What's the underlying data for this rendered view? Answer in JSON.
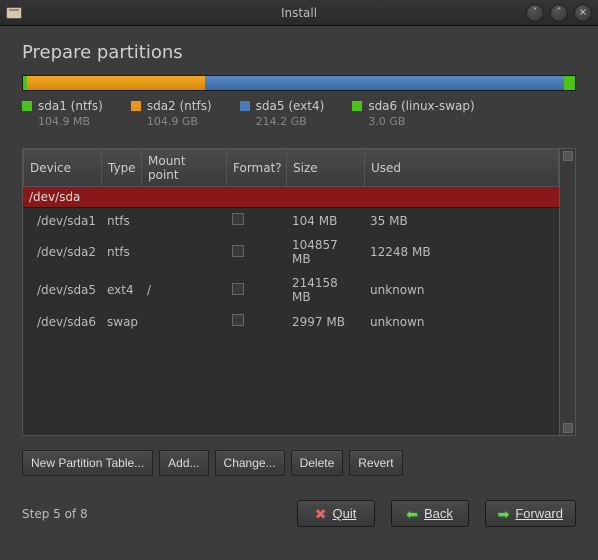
{
  "window": {
    "title": "Install"
  },
  "heading": "Prepare partitions",
  "legend": [
    {
      "swatch": "sw-green",
      "label": "sda1 (ntfs)",
      "size": "104.9 MB"
    },
    {
      "swatch": "sw-orange",
      "label": "sda2 (ntfs)",
      "size": "104.9 GB"
    },
    {
      "swatch": "sw-blue",
      "label": "sda5 (ext4)",
      "size": "214.2 GB"
    },
    {
      "swatch": "sw-green",
      "label": "sda6 (linux-swap)",
      "size": "3.0 GB"
    }
  ],
  "columns": {
    "device": "Device",
    "type": "Type",
    "mount": "Mount point",
    "format": "Format?",
    "size": "Size",
    "used": "Used"
  },
  "disk_row": "/dev/sda",
  "rows": [
    {
      "device": "/dev/sda1",
      "type": "ntfs",
      "mount": "",
      "size": "104 MB",
      "used": "35 MB"
    },
    {
      "device": "/dev/sda2",
      "type": "ntfs",
      "mount": "",
      "size": "104857 MB",
      "used": "12248 MB"
    },
    {
      "device": "/dev/sda5",
      "type": "ext4",
      "mount": "/",
      "size": "214158 MB",
      "used": "unknown"
    },
    {
      "device": "/dev/sda6",
      "type": "swap",
      "mount": "",
      "size": "2997 MB",
      "used": "unknown"
    }
  ],
  "buttons": {
    "new_table": "New Partition Table...",
    "add": "Add...",
    "change": "Change...",
    "delete": "Delete",
    "revert": "Revert"
  },
  "footer": {
    "step": "Step 5 of 8",
    "quit": "Quit",
    "back": "Back",
    "forward": "Forward"
  },
  "chart_data": {
    "type": "bar",
    "title": "Disk partition layout",
    "unit": "GB",
    "series": [
      {
        "name": "sda1 (ntfs)",
        "value": 0.1049,
        "color": "#4cc417"
      },
      {
        "name": "sda2 (ntfs)",
        "value": 104.9,
        "color": "#e69516"
      },
      {
        "name": "sda5 (ext4)",
        "value": 214.2,
        "color": "#4a7ab8"
      },
      {
        "name": "sda6 (linux-swap)",
        "value": 3.0,
        "color": "#4cc417"
      }
    ],
    "total": 322.2
  }
}
